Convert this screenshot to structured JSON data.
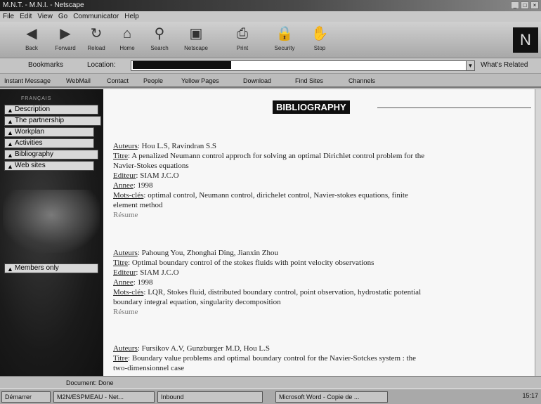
{
  "window": {
    "title": "M.N.T. - M.N.I. - Netscape"
  },
  "menu": [
    "File",
    "Edit",
    "View",
    "Go",
    "Communicator",
    "Help"
  ],
  "toolbar": [
    "Back",
    "Forward",
    "Reload",
    "Home",
    "Search",
    "Netscape",
    "Print",
    "Security",
    "Stop"
  ],
  "location": {
    "bookmarks": "Bookmarks",
    "label": "Location:",
    "related": "What's Related"
  },
  "personal": [
    "Instant Message",
    "WebMail",
    "Contact",
    "People",
    "Yellow Pages",
    "Download",
    "Find Sites",
    "Channels"
  ],
  "sidebar": {
    "top_label": "FRANÇAIS",
    "items": [
      "Description",
      "The partnership",
      "Workplan",
      "Activities",
      "Bibliography",
      "Web sites"
    ],
    "members": "Members only"
  },
  "page": {
    "heading": "BIBLIOGRAPHY"
  },
  "entries": [
    {
      "auteurs_label": "Auteurs",
      "auteurs": "Hou L.S, Ravindran S.S",
      "titre_label": "Titre",
      "titre_1": "A penalized Neumann control approch for solving an optimal Dirichlet control problem for the",
      "titre_2": "Navier-Stokes equations",
      "editeur_label": "Editeur",
      "editeur": "SIAM J.C.O",
      "annee_label": "Annee",
      "annee": "1998",
      "mots_label": "Mots-clés",
      "mots_1": "optimal control, Neumann control, dirichelet control, Navier-stokes equations, finite",
      "mots_2": "element method",
      "resume": "Résume"
    },
    {
      "auteurs_label": "Auteurs",
      "auteurs": "Pahoung You, Zhonghai Ding, Jianxin Zhou",
      "titre_label": "Titre",
      "titre_1": "Optimal boundary control of the stokes fluids with point velocity observations",
      "editeur_label": "Editeur",
      "editeur": "SIAM J.C.O",
      "annee_label": "Annee",
      "annee": "1998",
      "mots_label": "Mots-clés",
      "mots_1": "LQR, Stokes fluid, distributed boundary control, point observation, hydrostatic potential",
      "mots_2": "boundary integral equation, singularity decomposition",
      "resume": "Résume"
    },
    {
      "auteurs_label": "Auteurs",
      "auteurs": "Fursikov A.V, Gunzburger M.D, Hou L.S",
      "titre_label": "Titre",
      "titre_1": "Boundary value problems and optimal boundary control for the Navier-Sotckes system : the",
      "titre_2": "two-dimensionnel case"
    }
  ],
  "status": {
    "text": "Document: Done"
  },
  "taskbar": {
    "start": "Démarrer",
    "tasks": [
      "M2N/ESPMEAU - Net...",
      "Inbound",
      "Microsoft Word - Copie de ..."
    ],
    "clock": "15:17"
  }
}
